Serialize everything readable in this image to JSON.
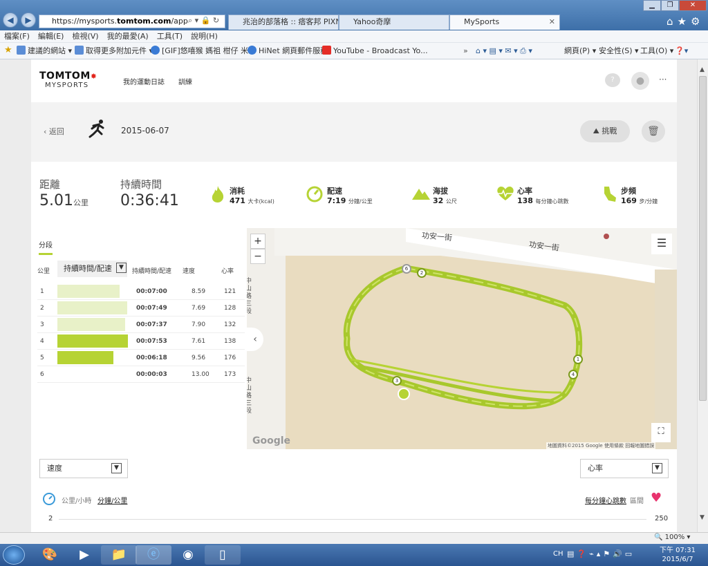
{
  "browser": {
    "address_url_prefix": "https://mysports.",
    "address_url_domain": "tomtom.com",
    "address_url_path": "/app/activity",
    "tabs": [
      {
        "label": "兆治的部落格 :: 痞客邦 PIXNE..."
      },
      {
        "label": "Yahoo奇摩"
      },
      {
        "label": "MySports"
      }
    ],
    "menu": [
      "檔案(F)",
      "編輯(E)",
      "檢視(V)",
      "我的最愛(A)",
      "工具(T)",
      "說明(H)"
    ],
    "favorites": [
      {
        "label": "建議的網站 ▾"
      },
      {
        "label": "取得更多附加元件 ▾"
      },
      {
        "label": "[GIF]悠嘻猴 媽祖 柑仔 米..."
      },
      {
        "label": "HiNet 網頁郵件服務"
      },
      {
        "label": "YouTube - Broadcast Yo..."
      }
    ],
    "cmd_right": [
      "網頁(P) ▾",
      "安全性(S) ▾",
      "工具(O) ▾"
    ],
    "zoom": "100%"
  },
  "site": {
    "brand_top": "TOMTOM",
    "brand_bottom": "MYSPORTS",
    "nav": [
      "我的運動日誌",
      "訓練"
    ],
    "more": "···"
  },
  "activity": {
    "back_label": "返回",
    "date": "2015-06-07",
    "challenge_label": "挑戰"
  },
  "stats": {
    "distance_label": "距離",
    "distance_value": "5.01",
    "distance_unit": "公里",
    "duration_label": "持續時間",
    "duration_value": "0:36:41",
    "items": [
      {
        "label": "消耗",
        "value": "471",
        "unit": "大卡(kcal)"
      },
      {
        "label": "配速",
        "value": "7:19",
        "unit": "分鐘/公里"
      },
      {
        "label": "海拔",
        "value": "32",
        "unit": "公尺"
      },
      {
        "label": "心率",
        "value": "138",
        "unit": "每分鐘心跳數"
      },
      {
        "label": "步頻",
        "value": "169",
        "unit": "步/分鐘"
      }
    ]
  },
  "splits": {
    "section_label": "分段",
    "headers": [
      "公里",
      "持續時間/配速",
      "持續時間/配速",
      "速度",
      "心率"
    ],
    "rows": [
      {
        "km": "1",
        "bar": 0.87,
        "hi": false,
        "time": "00:07:00",
        "speed": "8.59",
        "hr": "121"
      },
      {
        "km": "2",
        "bar": 0.97,
        "hi": false,
        "time": "00:07:49",
        "speed": "7.69",
        "hr": "128"
      },
      {
        "km": "3",
        "bar": 0.94,
        "hi": false,
        "time": "00:07:37",
        "speed": "7.90",
        "hr": "132"
      },
      {
        "km": "4",
        "bar": 0.98,
        "hi": true,
        "time": "00:07:53",
        "speed": "7.61",
        "hr": "138"
      },
      {
        "km": "5",
        "bar": 0.78,
        "hi": true,
        "time": "00:06:18",
        "speed": "9.56",
        "hr": "176"
      },
      {
        "km": "6",
        "bar": 0.0,
        "hi": false,
        "time": "00:00:03",
        "speed": "13.00",
        "hr": "173"
      }
    ]
  },
  "map": {
    "zoom_in": "+",
    "zoom_out": "−",
    "street_top_left": "功安一街",
    "street_top_right": "功安一街",
    "street_vertical": "中山路三段",
    "google_logo": "Google",
    "attribution": "地圖資料©2015 Google",
    "terms": "使用條款",
    "report": "回報地圖錯誤",
    "markers": [
      "1",
      "2",
      "3",
      "4",
      "5",
      "6"
    ]
  },
  "chart_controls": {
    "left_select": "速度",
    "right_select": "心率",
    "left_unit_a": "公里/小時",
    "left_unit_b": "分鐘/公里",
    "right_unit_a": "每分鐘心跳數",
    "right_unit_b": "區間",
    "axis_min": "2",
    "axis_max": "250"
  },
  "taskbar": {
    "lang": "CH",
    "time": "下午 07:31",
    "date": "2015/6/7"
  },
  "colors": {
    "accent_green": "#b6d334",
    "bar_light": "#e8f1c8",
    "heart_pink": "#e8336e",
    "brand_red": "#e2231a"
  }
}
